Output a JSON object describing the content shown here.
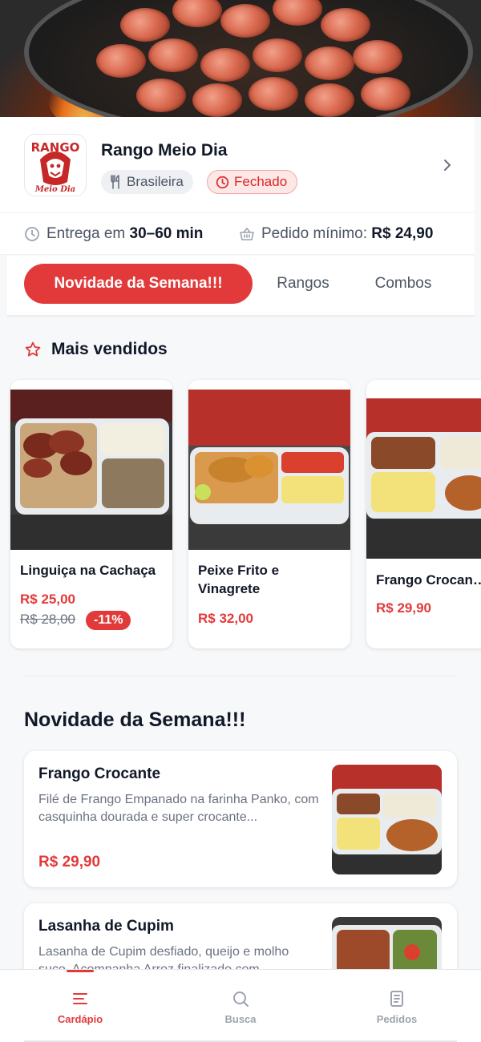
{
  "store": {
    "name": "Rango Meio Dia",
    "cuisine": "Brasileira",
    "status": "Fechado",
    "logo_text_top": "RANGO",
    "logo_text_bottom": "Meio Dia"
  },
  "delivery": {
    "eta_prefix": "Entrega em",
    "eta_value": "30–60 min",
    "min_prefix": "Pedido mínimo:",
    "min_value": "R$ 24,90"
  },
  "tabs": [
    {
      "label": "Novidade da Semana!!!",
      "active": true
    },
    {
      "label": "Rangos",
      "active": false
    },
    {
      "label": "Combos",
      "active": false
    }
  ],
  "best_sellers": {
    "title": "Mais vendidos",
    "items": [
      {
        "name": "Linguiça na Cachaça",
        "price": "R$ 25,00",
        "old_price": "R$ 28,00",
        "discount": "-11%"
      },
      {
        "name": "Peixe Frito e Vinagrete",
        "price": "R$ 32,00"
      },
      {
        "name": "Frango Crocan…",
        "price": "R$ 29,90"
      }
    ]
  },
  "weekly": {
    "title": "Novidade da Semana!!!",
    "items": [
      {
        "title": "Frango Crocante",
        "description": "Filé de Frango Empanado na farinha Panko, com casquinha dourada e super crocante...",
        "price": "R$ 29,90"
      },
      {
        "title": "Lasanha de Cupim",
        "description": "Lasanha de Cupim desfiado, queijo e molho suco. Acompanha Arroz finalizado com",
        "price": ""
      }
    ]
  },
  "bottom_nav": [
    {
      "label": "Cardápio",
      "icon": "menu-icon",
      "active": true
    },
    {
      "label": "Busca",
      "icon": "search-icon",
      "active": false
    },
    {
      "label": "Pedidos",
      "icon": "receipt-icon",
      "active": false
    }
  ],
  "colors": {
    "accent": "#e23a3a",
    "text": "#111827",
    "muted": "#6b7280"
  }
}
